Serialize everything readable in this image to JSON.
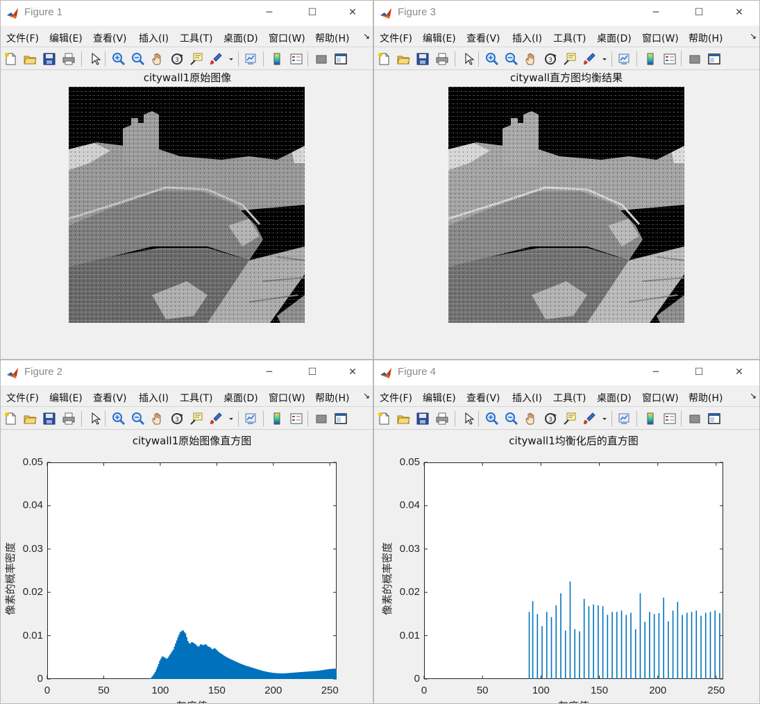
{
  "menu": [
    "文件(F)",
    "编辑(E)",
    "查看(V)",
    "插入(I)",
    "工具(T)",
    "桌面(D)",
    "窗口(W)",
    "帮助(H)"
  ],
  "menu_more": "↘",
  "window_buttons": {
    "minimize": "─",
    "maximize": "☐",
    "close": "✕"
  },
  "toolbar_icons": [
    "new-figure-icon",
    "open-icon",
    "save-icon",
    "print-icon",
    "pointer-icon",
    "zoom-in-icon",
    "zoom-out-icon",
    "pan-hand-icon",
    "rotate-3d-icon",
    "data-cursor-icon",
    "brush-icon",
    "link-plot-icon",
    "colorbar-icon",
    "legend-icon",
    "hide-plot-tools-icon",
    "show-plot-tools-icon"
  ],
  "colors": {
    "bar": "#0072bd",
    "axes": "#262626",
    "figure_bg": "#f0f0f0"
  },
  "windows": [
    {
      "title": "Figure 1",
      "plot_title": "citywall1原始图像",
      "kind": "image"
    },
    {
      "title": "Figure 3",
      "plot_title": "citywall直方图均衡结果",
      "kind": "image"
    },
    {
      "title": "Figure 2",
      "plot_title": "citywall1原始图像直方图",
      "kind": "histogram"
    },
    {
      "title": "Figure 4",
      "plot_title": "citywall1均衡化后的直方图",
      "kind": "histogram"
    }
  ],
  "chart_data": [
    {
      "type": "bar",
      "title": "citywall1原始图像直方图",
      "xlabel": "灰度值",
      "ylabel": "像素的概率密度",
      "xlim": [
        0,
        256
      ],
      "ylim": [
        0,
        0.05
      ],
      "xticks": [
        "0",
        "50",
        "100",
        "150",
        "200",
        "250"
      ],
      "yticks": [
        "0",
        "0.01",
        "0.02",
        "0.03",
        "0.04",
        "0.05"
      ],
      "x": [
        92,
        94,
        96,
        98,
        100,
        102,
        104,
        106,
        108,
        110,
        112,
        114,
        116,
        118,
        120,
        122,
        124,
        126,
        128,
        130,
        132,
        134,
        136,
        138,
        140,
        142,
        144,
        146,
        148,
        150,
        152,
        154,
        156,
        158,
        160,
        165,
        170,
        175,
        180,
        185,
        190,
        195,
        200,
        205,
        210,
        215,
        220,
        225,
        230,
        235,
        240,
        245,
        250,
        255
      ],
      "values": [
        0.0002,
        0.0008,
        0.0016,
        0.0028,
        0.0042,
        0.0052,
        0.0049,
        0.0045,
        0.0052,
        0.006,
        0.0068,
        0.0082,
        0.0096,
        0.0108,
        0.0112,
        0.0105,
        0.0088,
        0.0079,
        0.0085,
        0.0082,
        0.0077,
        0.0073,
        0.008,
        0.0077,
        0.008,
        0.0075,
        0.0073,
        0.0067,
        0.0071,
        0.0066,
        0.0061,
        0.0058,
        0.0054,
        0.0051,
        0.0048,
        0.0042,
        0.0036,
        0.0031,
        0.0027,
        0.0023,
        0.0019,
        0.0016,
        0.0014,
        0.0013,
        0.0013,
        0.0014,
        0.0015,
        0.0016,
        0.0017,
        0.0018,
        0.0019,
        0.0021,
        0.0023,
        0.0024
      ]
    },
    {
      "type": "bar",
      "title": "citywall1均衡化后的直方图",
      "xlabel": "灰度值",
      "ylabel": "像素的概率密度",
      "xlim": [
        0,
        256
      ],
      "ylim": [
        0,
        0.05
      ],
      "xticks": [
        "0",
        "50",
        "100",
        "150",
        "200",
        "250"
      ],
      "yticks": [
        "0",
        "0.01",
        "0.02",
        "0.03",
        "0.04",
        "0.05"
      ],
      "x": [
        90,
        93,
        97,
        101,
        105,
        109,
        113,
        117,
        121,
        125,
        129,
        133,
        137,
        141,
        145,
        149,
        153,
        157,
        161,
        165,
        169,
        173,
        177,
        181,
        185,
        189,
        193,
        197,
        201,
        205,
        209,
        213,
        217,
        221,
        225,
        229,
        233,
        237,
        241,
        245,
        249,
        253
      ],
      "values": [
        0.0155,
        0.018,
        0.015,
        0.0122,
        0.0155,
        0.0143,
        0.017,
        0.0198,
        0.0112,
        0.0225,
        0.0115,
        0.011,
        0.0185,
        0.0168,
        0.0172,
        0.017,
        0.0168,
        0.0148,
        0.0155,
        0.0155,
        0.0158,
        0.0148,
        0.0153,
        0.0115,
        0.0198,
        0.0132,
        0.0155,
        0.015,
        0.0152,
        0.0188,
        0.0133,
        0.0158,
        0.0178,
        0.0148,
        0.0153,
        0.0155,
        0.0158,
        0.0146,
        0.0153,
        0.0155,
        0.0158,
        0.0152
      ]
    }
  ]
}
